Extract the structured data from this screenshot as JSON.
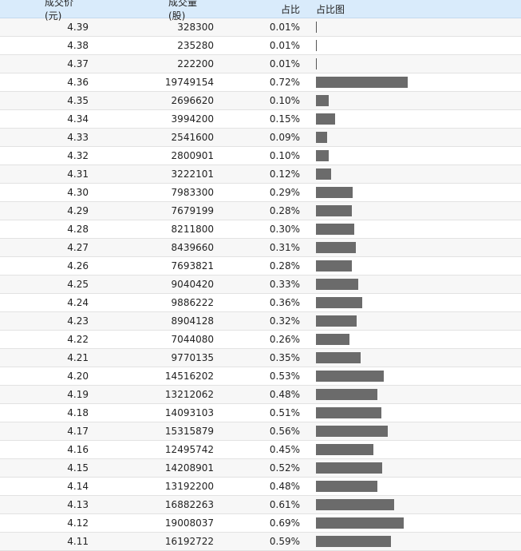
{
  "header": {
    "price": "成交价(元)",
    "volume": "成交量(股)",
    "ratio": "占比",
    "chart": "占比图"
  },
  "colors": {
    "header_bg": "#d9ebfb",
    "bar": "#6b6b6b"
  },
  "rows": [
    {
      "price": "4.39",
      "volume": "328300",
      "ratio": "0.01%",
      "pct": 0.01
    },
    {
      "price": "4.38",
      "volume": "235280",
      "ratio": "0.01%",
      "pct": 0.01
    },
    {
      "price": "4.37",
      "volume": "222200",
      "ratio": "0.01%",
      "pct": 0.01
    },
    {
      "price": "4.36",
      "volume": "19749154",
      "ratio": "0.72%",
      "pct": 0.72
    },
    {
      "price": "4.35",
      "volume": "2696620",
      "ratio": "0.10%",
      "pct": 0.1
    },
    {
      "price": "4.34",
      "volume": "3994200",
      "ratio": "0.15%",
      "pct": 0.15
    },
    {
      "price": "4.33",
      "volume": "2541600",
      "ratio": "0.09%",
      "pct": 0.09
    },
    {
      "price": "4.32",
      "volume": "2800901",
      "ratio": "0.10%",
      "pct": 0.1
    },
    {
      "price": "4.31",
      "volume": "3222101",
      "ratio": "0.12%",
      "pct": 0.12
    },
    {
      "price": "4.30",
      "volume": "7983300",
      "ratio": "0.29%",
      "pct": 0.29
    },
    {
      "price": "4.29",
      "volume": "7679199",
      "ratio": "0.28%",
      "pct": 0.28
    },
    {
      "price": "4.28",
      "volume": "8211800",
      "ratio": "0.30%",
      "pct": 0.3
    },
    {
      "price": "4.27",
      "volume": "8439660",
      "ratio": "0.31%",
      "pct": 0.31
    },
    {
      "price": "4.26",
      "volume": "7693821",
      "ratio": "0.28%",
      "pct": 0.28
    },
    {
      "price": "4.25",
      "volume": "9040420",
      "ratio": "0.33%",
      "pct": 0.33
    },
    {
      "price": "4.24",
      "volume": "9886222",
      "ratio": "0.36%",
      "pct": 0.36
    },
    {
      "price": "4.23",
      "volume": "8904128",
      "ratio": "0.32%",
      "pct": 0.32
    },
    {
      "price": "4.22",
      "volume": "7044080",
      "ratio": "0.26%",
      "pct": 0.26
    },
    {
      "price": "4.21",
      "volume": "9770135",
      "ratio": "0.35%",
      "pct": 0.35
    },
    {
      "price": "4.20",
      "volume": "14516202",
      "ratio": "0.53%",
      "pct": 0.53
    },
    {
      "price": "4.19",
      "volume": "13212062",
      "ratio": "0.48%",
      "pct": 0.48
    },
    {
      "price": "4.18",
      "volume": "14093103",
      "ratio": "0.51%",
      "pct": 0.51
    },
    {
      "price": "4.17",
      "volume": "15315879",
      "ratio": "0.56%",
      "pct": 0.56
    },
    {
      "price": "4.16",
      "volume": "12495742",
      "ratio": "0.45%",
      "pct": 0.45
    },
    {
      "price": "4.15",
      "volume": "14208901",
      "ratio": "0.52%",
      "pct": 0.52
    },
    {
      "price": "4.14",
      "volume": "13192200",
      "ratio": "0.48%",
      "pct": 0.48
    },
    {
      "price": "4.13",
      "volume": "16882263",
      "ratio": "0.61%",
      "pct": 0.61
    },
    {
      "price": "4.12",
      "volume": "19008037",
      "ratio": "0.69%",
      "pct": 0.69
    },
    {
      "price": "4.11",
      "volume": "16192722",
      "ratio": "0.59%",
      "pct": 0.59
    }
  ]
}
